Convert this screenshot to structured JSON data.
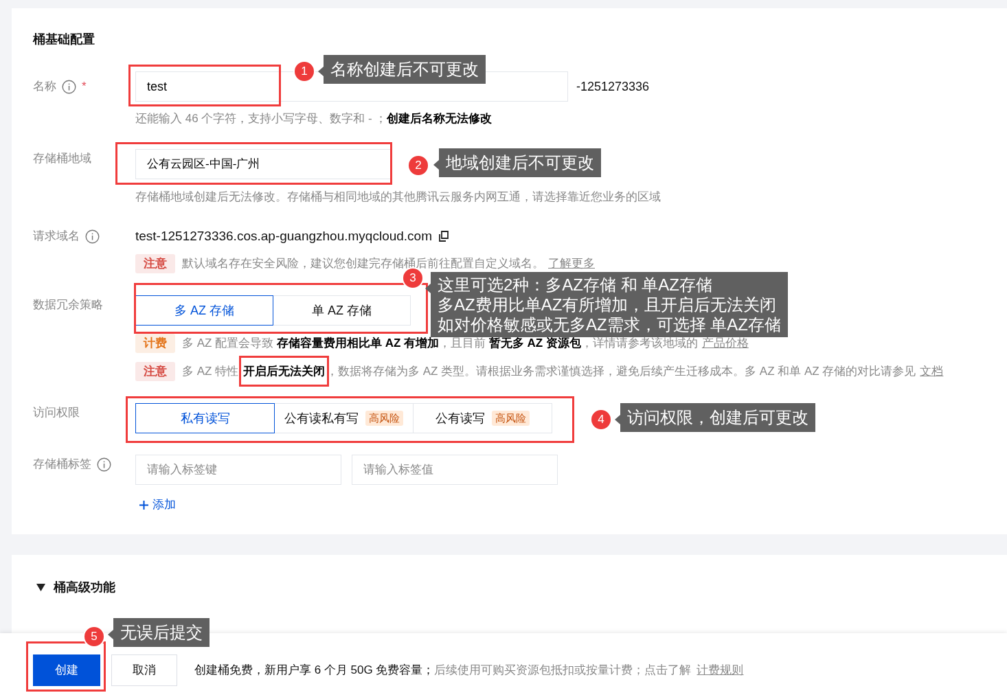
{
  "basic": {
    "title": "桶基础配置",
    "name": {
      "label": "名称",
      "info": true,
      "required_mark": "*",
      "value": "test",
      "suffix": "-1251273336",
      "hint": "还能输入 46 个字符，支持小写字母、数字和 - ；**创建后名称无法修改**"
    },
    "region": {
      "label": "存储桶地域",
      "value": "公有云园区-中国-广州",
      "hint": "存储桶地域创建后无法修改。存储桶与相同地域的其他腾讯云服务内网互通，请选择靠近您业务的区域"
    },
    "domain": {
      "label": "请求域名",
      "info": true,
      "value": "test-1251273336.cos.ap-guangzhou.myqcloud.com",
      "notice": {
        "tag": "注意",
        "color": "#d54941",
        "text": "默认域名存在安全风险，建议您创建完存储桶后前往配置自定义域名。",
        "link": "了解更多"
      }
    },
    "redundancy": {
      "label": "数据冗余策略",
      "options": [
        {
          "label": "多 AZ 存储",
          "selected": true
        },
        {
          "label": "单 AZ 存储",
          "selected": false
        }
      ],
      "notices": [
        {
          "tag": "计费",
          "color": "#e37318",
          "text": "多 AZ 配置会导致 **存储容量费用相比单 AZ 有增加**，且目前 **暂无多 AZ 资源包**，详情请参考该地域的",
          "link": "产品价格"
        },
        {
          "tag": "注意",
          "color": "#d54941",
          "text": "多 AZ 特性 **开启后无法关闭**，数据将存储为多 AZ 类型。请根据业务需求谨慎选择，避免后续产生迁移成本。多 AZ 和单 AZ 存储的对比请参见",
          "link": "文档"
        }
      ]
    },
    "access": {
      "label": "访问权限",
      "options": [
        {
          "label": "私有读写",
          "selected": true
        },
        {
          "label": "公有读私有写",
          "badge": "高风险",
          "selected": false
        },
        {
          "label": "公有读写",
          "badge": "高风险",
          "selected": false
        }
      ]
    },
    "tags": {
      "label": "存储桶标签",
      "info": true,
      "key_placeholder": "请输入标签键",
      "value_placeholder": "请输入标签值",
      "add": "添加"
    }
  },
  "advanced": {
    "title": "桶高级功能",
    "expanded": true
  },
  "footer": {
    "create": "创建",
    "cancel": "取消",
    "note": "创建桶免费，新用户享 6 个月 50G 免费容量；",
    "note_extra": "后续使用可购买资源包抵扣或按量计费；点击了解",
    "link": "计费规则"
  },
  "annotations": [
    {
      "number": "1",
      "lines": [
        "名称创建后不可更改"
      ]
    },
    {
      "number": "2",
      "lines": [
        "地域创建后不可更改"
      ]
    },
    {
      "number": "3",
      "lines": [
        "这里可选2种：多AZ存储 和 单AZ存储",
        "多AZ费用比单AZ有所增加，且开启后无法关闭",
        "如对价格敏感或无多AZ需求，可选择 单AZ存储"
      ]
    },
    {
      "number": "4",
      "lines": [
        "访问权限，创建后可更改"
      ]
    },
    {
      "number": "5",
      "lines": [
        "无误后提交"
      ]
    }
  ]
}
